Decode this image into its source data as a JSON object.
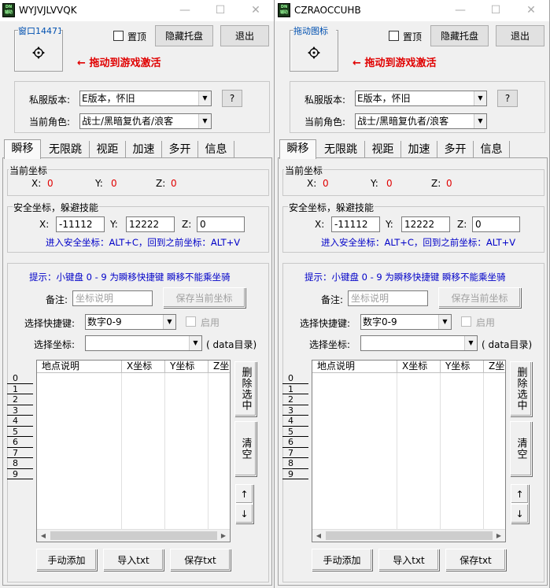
{
  "windows": [
    {
      "title": "WYJVJLVVQK",
      "drag_box_title": "窗口14471!",
      "pin_label": "置顶",
      "hide_tray_label": "隐藏托盘",
      "exit_label": "退出",
      "drag_hint": "拖动到游戏激活",
      "version_label": "私服版本:",
      "version_value": "E版本，怀旧",
      "help_label": "?",
      "role_label": "当前角色:",
      "role_value": "战士/黑暗复仇者/浪客",
      "tabs": [
        "瞬移",
        "无限跳",
        "视距",
        "加速",
        "多开",
        "信息"
      ],
      "current_coord_title": "当前坐标",
      "x_label": "X:",
      "x_val": "0",
      "y_label": "Y:",
      "y_val": "0",
      "z_label": "Z:",
      "z_val": "0",
      "safe_title": "安全坐标，躲避技能",
      "safe_x_label": "X:",
      "safe_x": "-11112",
      "safe_y_label": "Y:",
      "safe_y": "12222",
      "safe_z_label": "Z:",
      "safe_z": "0",
      "safe_hint": "进入安全坐标：ALT+C，回到之前坐标：ALT+V",
      "tip": "提示：小键盘 0 - 9 为瞬移快捷键  瞬移不能乘坐骑",
      "note_label": "备注:",
      "note_placeholder": "坐标说明",
      "save_coord_label": "保存当前坐标",
      "hotkey_label": "选择快捷键:",
      "hotkey_value": "数字0-9",
      "enable_label": "启用",
      "select_coord_label": "选择坐标:",
      "select_coord_value": "",
      "data_dir_label": "( data目录)",
      "keys": [
        "0",
        "1",
        "2",
        "3",
        "4",
        "5",
        "6",
        "7",
        "8",
        "9"
      ],
      "columns": [
        "地点说明",
        "X坐标",
        "Y坐标",
        "Z坐"
      ],
      "delete_label": "删除选中",
      "clear_label": "清空",
      "up_label": "↑",
      "down_label": "↓",
      "manual_add_label": "手动添加",
      "import_label": "导入txt",
      "save_txt_label": "保存txt"
    },
    {
      "title": "CZRAOCCUHB",
      "drag_box_title": "拖动图标",
      "pin_label": "置顶",
      "hide_tray_label": "隐藏托盘",
      "exit_label": "退出",
      "drag_hint": "拖动到游戏激活",
      "version_label": "私服版本:",
      "version_value": "E版本，怀旧",
      "help_label": "?",
      "role_label": "当前角色:",
      "role_value": "战士/黑暗复仇者/浪客",
      "tabs": [
        "瞬移",
        "无限跳",
        "视距",
        "加速",
        "多开",
        "信息"
      ],
      "current_coord_title": "当前坐标",
      "x_label": "X:",
      "x_val": "0",
      "y_label": "Y:",
      "y_val": "0",
      "z_label": "Z:",
      "z_val": "0",
      "safe_title": "安全坐标，躲避技能",
      "safe_x_label": "X:",
      "safe_x": "-11112",
      "safe_y_label": "Y:",
      "safe_y": "12222",
      "safe_z_label": "Z:",
      "safe_z": "0",
      "safe_hint": "进入安全坐标：ALT+C，回到之前坐标：ALT+V",
      "tip": "提示：小键盘 0 - 9 为瞬移快捷键  瞬移不能乘坐骑",
      "note_label": "备注:",
      "note_placeholder": "坐标说明",
      "save_coord_label": "保存当前坐标",
      "hotkey_label": "选择快捷键:",
      "hotkey_value": "数字0-9",
      "enable_label": "启用",
      "select_coord_label": "选择坐标:",
      "select_coord_value": "",
      "data_dir_label": "( data目录)",
      "keys": [
        "0",
        "1",
        "2",
        "3",
        "4",
        "5",
        "6",
        "7",
        "8",
        "9"
      ],
      "columns": [
        "地点说明",
        "X坐标",
        "Y坐标",
        "Z坐"
      ],
      "delete_label": "删除选中",
      "clear_label": "清空",
      "up_label": "↑",
      "down_label": "↓",
      "manual_add_label": "手动添加",
      "import_label": "导入txt",
      "save_txt_label": "保存txt"
    }
  ],
  "colors": {
    "hint_red": "#e00000",
    "hint_blue": "#0000c8",
    "drag_title_blue": "#0050b0"
  }
}
